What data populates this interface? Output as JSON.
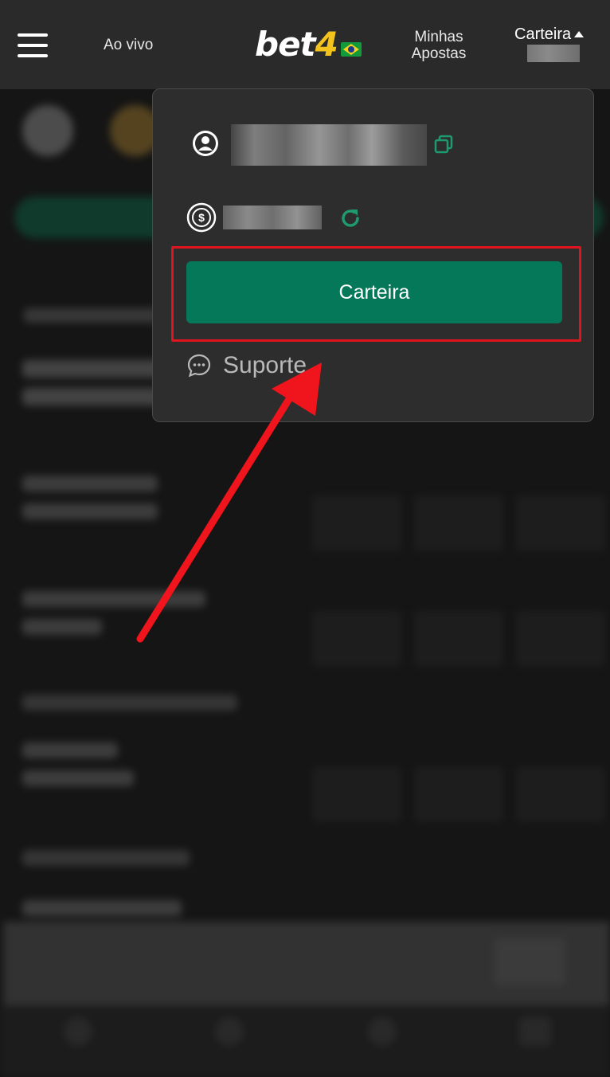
{
  "header": {
    "menu_icon": "hamburger-icon",
    "live_label": "Ao vivo",
    "logo": {
      "brand": "bet",
      "number": "4",
      "flag_icon": "brazil-flag-icon"
    },
    "my_bets_label": "Minhas Apostas",
    "wallet_label": "Carteira",
    "wallet_caret_icon": "caret-up-icon"
  },
  "dropdown": {
    "user_icon": "user-circle-icon",
    "copy_icon": "copy-icon",
    "balance_icon": "dollar-coin-icon",
    "refresh_icon": "refresh-icon",
    "wallet_button_label": "Carteira",
    "support_icon": "chat-bubble-icon",
    "support_label": "Suporte"
  },
  "annotation": {
    "highlight_color": "#e0141c",
    "arrow_color": "#f0141c"
  },
  "colors": {
    "accent_green": "#06785a",
    "icon_green": "#1e9a6e",
    "logo_yellow": "#f4c21c",
    "panel_bg": "#2d2d2d"
  }
}
